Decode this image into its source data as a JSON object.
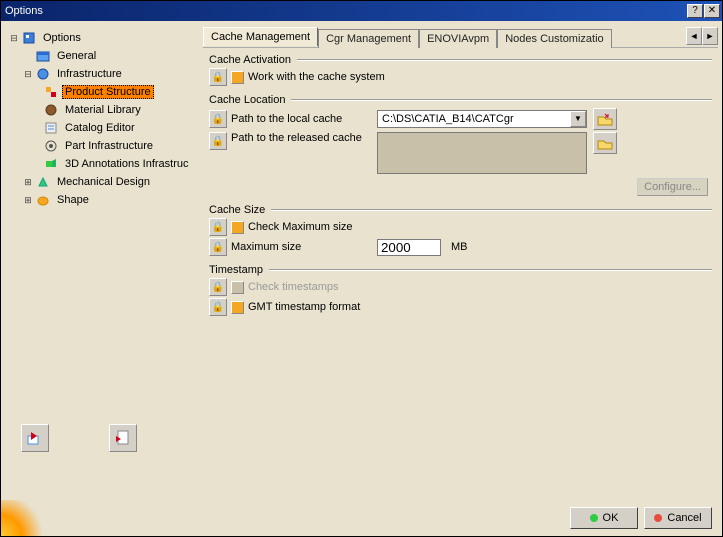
{
  "window": {
    "title": "Options"
  },
  "tree": {
    "root": "Options",
    "general": "General",
    "infrastructure": "Infrastructure",
    "product_structure": "Product Structure",
    "material_library": "Material Library",
    "catalog_editor": "Catalog Editor",
    "part_infrastructure": "Part Infrastructure",
    "annotations": "3D Annotations Infrastruc",
    "mechanical": "Mechanical Design",
    "shape": "Shape"
  },
  "tabs": {
    "cache_mgmt": "Cache Management",
    "cgr_mgmt": "Cgr Management",
    "enovia": "ENOVIAvpm",
    "nodes": "Nodes Customizatio"
  },
  "groups": {
    "activation": {
      "title": "Cache Activation",
      "work_with": "Work with the cache system"
    },
    "location": {
      "title": "Cache Location",
      "local_path_label": "Path to the local cache",
      "local_path_value": "C:\\DS\\CATIA_B14\\CATCgr",
      "released_path_label": "Path to the released cache",
      "configure": "Configure..."
    },
    "size": {
      "title": "Cache Size",
      "check_max": "Check Maximum size",
      "max_label": "Maximum size",
      "max_value": "2000",
      "unit": "MB"
    },
    "timestamp": {
      "title": "Timestamp",
      "check_ts": "Check timestamps",
      "gmt": "GMT timestamp format"
    }
  },
  "buttons": {
    "ok": "OK",
    "cancel": "Cancel"
  }
}
